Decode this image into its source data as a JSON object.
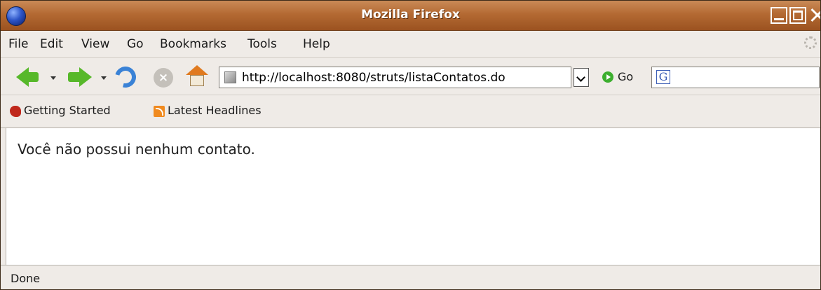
{
  "window": {
    "title": "Mozilla Firefox",
    "icon": "firefox-globe-icon",
    "controls": [
      "minimize-icon",
      "maximize-icon",
      "close-icon"
    ]
  },
  "menubar": {
    "items": [
      {
        "label": "File"
      },
      {
        "label": "Edit"
      },
      {
        "label": "View"
      },
      {
        "label": "Go"
      },
      {
        "label": "Bookmarks"
      },
      {
        "label": "Tools"
      },
      {
        "label": "Help"
      }
    ],
    "throbber_icon": "throbber-icon"
  },
  "navbar": {
    "back_icon": "back-arrow-icon",
    "forward_icon": "forward-arrow-icon",
    "reload_icon": "reload-icon",
    "stop_icon": "stop-icon",
    "home_icon": "home-icon",
    "url": "http://localhost:8080/struts/listaContatos.do",
    "go_label": "Go",
    "search_engine_icon": "google-icon",
    "search_value": ""
  },
  "bookmarks": {
    "items": [
      {
        "label": "Getting Started",
        "icon": "getting-started-icon"
      },
      {
        "label": "Latest Headlines",
        "icon": "rss-icon"
      }
    ]
  },
  "content": {
    "message": "Você não possui nenhum contato."
  },
  "status": {
    "text": "Done"
  },
  "colors": {
    "titlebar": "#b46a33",
    "chrome": "#efebe7",
    "accent_green": "#57b82a"
  }
}
